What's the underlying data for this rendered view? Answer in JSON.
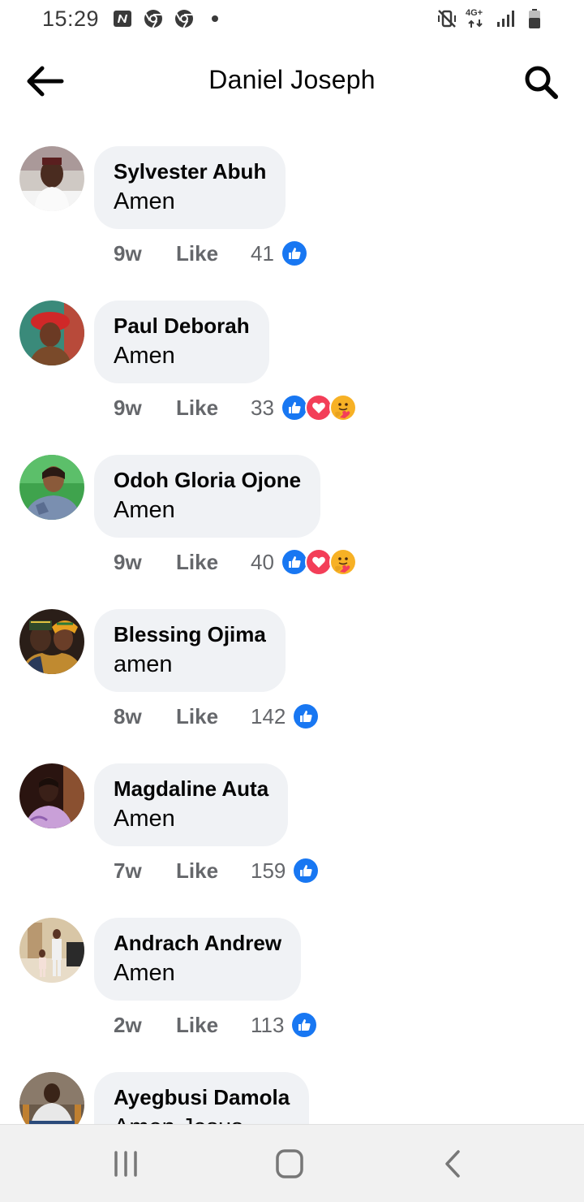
{
  "status_bar": {
    "time": "15:29",
    "left_icons": [
      "n-notification-icon",
      "chrome-icon",
      "chrome-icon",
      "dot-icon"
    ],
    "right_icons": [
      "vibrate-mute-icon",
      "4g-icon",
      "signal-icon",
      "battery-icon"
    ],
    "network": "4G+"
  },
  "header": {
    "title": "Daniel Joseph",
    "back_icon": "arrow-left-icon",
    "search_icon": "search-icon"
  },
  "colors": {
    "bubble": "#f0f2f5",
    "meta_text": "#65676b",
    "like_blue": "#1877f2",
    "love_red": "#f33e58",
    "care_yellow": "#f7b125"
  },
  "comments": [
    {
      "author": "Sylvester Abuh",
      "text": "Amen",
      "time": "9w",
      "like_label": "Like",
      "reaction_count": "41",
      "reactions": [
        "like"
      ]
    },
    {
      "author": "Paul Deborah",
      "text": "Amen",
      "time": "9w",
      "like_label": "Like",
      "reaction_count": "33",
      "reactions": [
        "like",
        "love",
        "care"
      ]
    },
    {
      "author": "Odoh Gloria Ojone",
      "text": "Amen",
      "time": "9w",
      "like_label": "Like",
      "reaction_count": "40",
      "reactions": [
        "like",
        "love",
        "care"
      ]
    },
    {
      "author": "Blessing Ojima",
      "text": "amen",
      "time": "8w",
      "like_label": "Like",
      "reaction_count": "142",
      "reactions": [
        "like"
      ]
    },
    {
      "author": "Magdaline Auta",
      "text": "Amen",
      "time": "7w",
      "like_label": "Like",
      "reaction_count": "159",
      "reactions": [
        "like"
      ]
    },
    {
      "author": "Andrach Andrew",
      "text": "Amen",
      "time": "2w",
      "like_label": "Like",
      "reaction_count": "113",
      "reactions": [
        "like"
      ]
    },
    {
      "author": "Ayegbusi Damola",
      "text": "Amen Jesus",
      "time": "",
      "like_label": "",
      "reaction_count": "",
      "reactions": []
    }
  ],
  "nav_bar": {
    "recents_icon": "recent-apps-icon",
    "home_icon": "home-icon",
    "back_icon": "back-chevron-icon"
  }
}
